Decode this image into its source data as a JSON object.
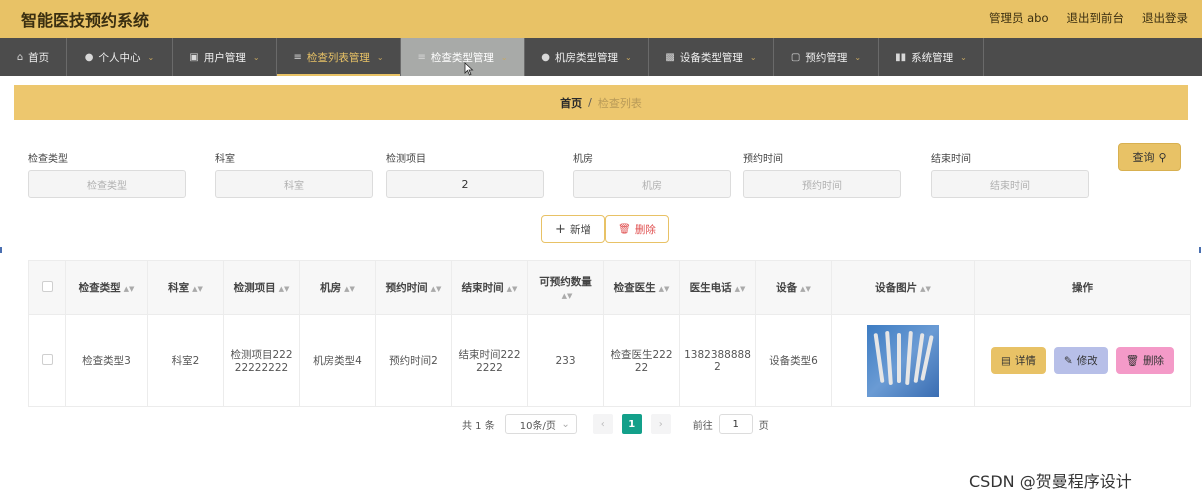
{
  "header": {
    "title": "智能医技预约系统",
    "user": "管理员 abo",
    "back_to_front": "退出到前台",
    "logout": "退出登录"
  },
  "nav": {
    "items": [
      {
        "label": "首页",
        "icon": "home-icon",
        "caret": false
      },
      {
        "label": "个人中心",
        "icon": "user-icon",
        "caret": true
      },
      {
        "label": "用户管理",
        "icon": "badge-icon",
        "caret": true
      },
      {
        "label": "检查列表管理",
        "icon": "list-icon",
        "caret": true
      },
      {
        "label": "检查类型管理",
        "icon": "list-icon",
        "caret": true
      },
      {
        "label": "机房类型管理",
        "icon": "user-icon",
        "caret": true
      },
      {
        "label": "设备类型管理",
        "icon": "ticket-icon",
        "caret": true
      },
      {
        "label": "预约管理",
        "icon": "monitor-icon",
        "caret": true
      },
      {
        "label": "系统管理",
        "icon": "chart-icon",
        "caret": true
      }
    ],
    "active_index": 3,
    "hover_index": 4
  },
  "breadcrumb": {
    "home": "首页",
    "separator": "/",
    "current": "检查列表"
  },
  "search": {
    "fields": [
      {
        "label": "检查类型",
        "placeholder": "检查类型",
        "value": ""
      },
      {
        "label": "科室",
        "placeholder": "科室",
        "value": ""
      },
      {
        "label": "检测项目",
        "placeholder": "检测项目",
        "value": "2"
      },
      {
        "label": "机房",
        "placeholder": "机房",
        "value": ""
      },
      {
        "label": "预约时间",
        "placeholder": "预约时间",
        "value": ""
      },
      {
        "label": "结束时间",
        "placeholder": "结束时间",
        "value": ""
      }
    ],
    "query_label": "查询"
  },
  "actions": {
    "add_label": "新增",
    "delete_label": "删除"
  },
  "table": {
    "columns": [
      "检查类型",
      "科室",
      "检测项目",
      "机房",
      "预约时间",
      "结束时间",
      "可预约数量",
      "检查医生",
      "医生电话",
      "设备",
      "设备图片",
      "操作"
    ],
    "rows": [
      {
        "cells": [
          "检查类型3",
          "科室2",
          "检测项目22222222222",
          "机房类型4",
          "预约时间2",
          "结束时间2222222",
          "233",
          "检查医生22222",
          "13823888882",
          "设备类型6"
        ],
        "ops": [
          "详情",
          "修改",
          "删除"
        ]
      }
    ]
  },
  "pagination": {
    "total": "共 1 条",
    "page_size": "10条/页",
    "current_page": "1",
    "goto_label": "前往",
    "goto_value": "1",
    "page_unit": "页"
  },
  "watermark": "CSDN @贺曼程序设计",
  "colors": {
    "header_bg": "#e8c266",
    "nav_bg": "#4c4c4c",
    "accent": "#e8c266",
    "pager_active": "#13a08a",
    "edit_btn": "#b7bfe8",
    "delete_btn": "#f49ac8"
  }
}
